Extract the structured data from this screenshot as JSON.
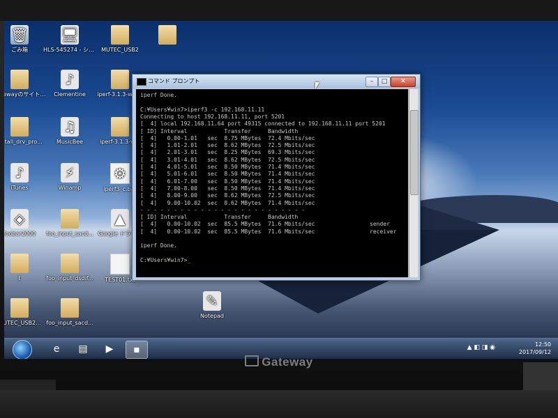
{
  "desktop": {
    "icons": [
      {
        "label": "ごみ箱",
        "glyph": "🗑",
        "kind": "recycle"
      },
      {
        "label": "HLS-545274 - ショートカット",
        "glyph": "🖥",
        "kind": "shortcut"
      },
      {
        "label": "MUTEC_USB2",
        "glyph": "",
        "kind": "folder"
      },
      {
        "label": "",
        "glyph": "",
        "kind": "folder"
      },
      {
        "label": "Gatewayのサイトにあった6.4bit...",
        "glyph": "",
        "kind": "folder"
      },
      {
        "label": "Clementine",
        "glyph": "♪",
        "kind": "shortcut"
      },
      {
        "label": "iperf-3.1.3-win...",
        "glyph": "",
        "kind": "folder"
      },
      {
        "label": "install_drv_pro...",
        "glyph": "",
        "kind": "folder"
      },
      {
        "label": "MusicBee",
        "glyph": "♫",
        "kind": "shortcut"
      },
      {
        "label": "iperf-3.1.3-win",
        "glyph": "",
        "kind": "folder"
      },
      {
        "label": "iTunes",
        "glyph": "♪",
        "kind": "shortcut"
      },
      {
        "label": "Winamp",
        "glyph": "⚡",
        "kind": "shortcut"
      },
      {
        "label": "iperf3_c.bat",
        "glyph": "⚙",
        "kind": "file"
      },
      {
        "label": "foobar2000",
        "glyph": "◈",
        "kind": "shortcut"
      },
      {
        "label": "foo_input_sacd...",
        "glyph": "",
        "kind": "folder"
      },
      {
        "label": "Google ドライブ",
        "glyph": "▲",
        "kind": "shortcut"
      },
      {
        "label": "t",
        "glyph": "",
        "kind": "folder"
      },
      {
        "label": "foo_input_dsdif...",
        "glyph": "",
        "kind": "folder"
      },
      {
        "label": "TEST01.txt",
        "glyph": "",
        "kind": "file"
      },
      {
        "label": "MUTEC_USB2...",
        "glyph": "",
        "kind": "folder"
      },
      {
        "label": "foo_input_sacd...",
        "glyph": "",
        "kind": "folder"
      },
      {
        "label": "Notepad",
        "glyph": "✎",
        "kind": "shortcut"
      }
    ]
  },
  "window": {
    "title": "コマンド プロンプト",
    "minimize": "–",
    "maximize": "□",
    "close": "✕"
  },
  "console": {
    "lines": [
      "iperf Done.",
      "",
      "C:¥Users¥win7>iperf3 -c 192.168.11.11",
      "Connecting to host 192.168.11.11, port 5201",
      "[  4] local 192.168.11.64 port 49315 connected to 192.168.11.11 port 5201",
      "[ ID] Interval           Transfer     Bandwidth",
      "[  4]   0.00-1.01   sec  8.75 MBytes  72.4 Mbits/sec",
      "[  4]   1.01-2.01   sec  8.62 MBytes  72.5 Mbits/sec",
      "[  4]   2.01-3.01   sec  8.25 MBytes  69.3 Mbits/sec",
      "[  4]   3.01-4.01   sec  8.62 MBytes  72.5 Mbits/sec",
      "[  4]   4.01-5.01   sec  8.50 MBytes  71.4 Mbits/sec",
      "[  4]   5.01-6.01   sec  8.50 MBytes  71.4 Mbits/sec",
      "[  4]   6.01-7.00   sec  8.50 MBytes  71.4 Mbits/sec",
      "[  4]   7.00-8.00   sec  8.50 MBytes  71.4 Mbits/sec",
      "[  4]   8.00-9.00   sec  8.62 MBytes  72.5 Mbits/sec",
      "[  4]   9.00-10.02  sec  8.62 MBytes  71.4 Mbits/sec",
      "- - - - - - - - - - - - - - - - - - - - - - - - -",
      "[ ID] Interval           Transfer     Bandwidth",
      "[  4]   0.00-10.02  sec  85.5 MBytes  71.6 Mbits/sec",
      "[  4]   0.00-10.02  sec  85.5 MBytes  71.6 Mbits/sec",
      "",
      "iperf Done.",
      "",
      "C:¥Users¥win7>_"
    ],
    "sender_label": "sender",
    "receiver_label": "receiver"
  },
  "taskbar": {
    "items": [
      "e",
      "▤",
      "▶",
      "▪"
    ],
    "clock_time": "12:50",
    "clock_date": "2017/09/12"
  },
  "brand": "Gateway"
}
